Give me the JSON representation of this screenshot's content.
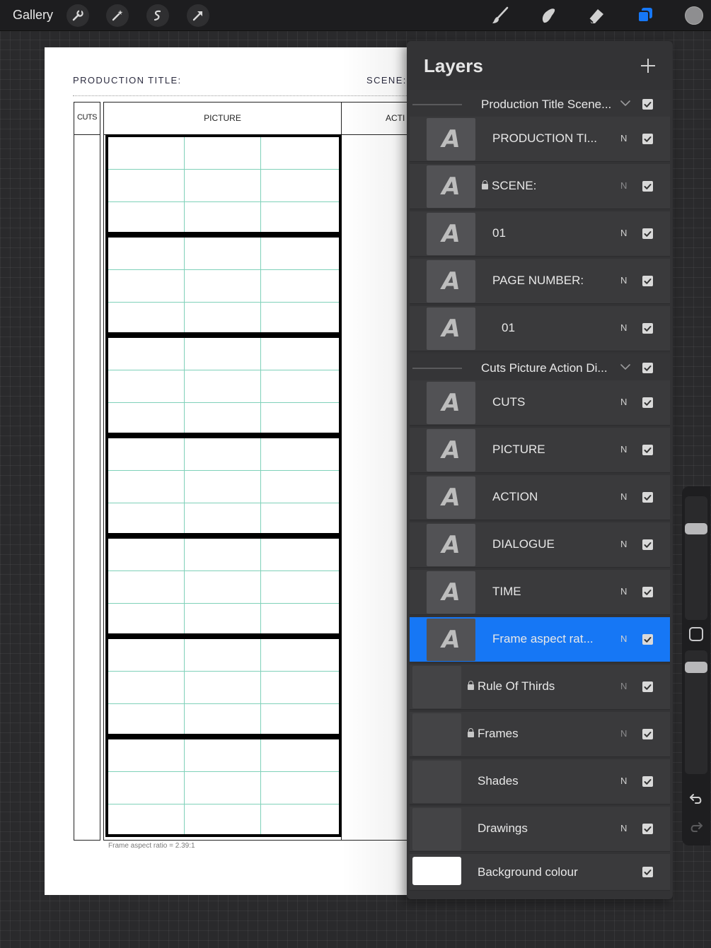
{
  "toolbar": {
    "gallery_label": "Gallery",
    "left_tools": [
      {
        "icon": "wrench-icon"
      },
      {
        "icon": "magic-wand-icon"
      },
      {
        "icon": "selection-icon"
      },
      {
        "icon": "transform-arrow-icon"
      }
    ],
    "right_tools": [
      {
        "icon": "brush-icon"
      },
      {
        "icon": "smudge-icon"
      },
      {
        "icon": "eraser-icon"
      },
      {
        "icon": "layers-icon",
        "active": true
      }
    ],
    "color_swatch": "#8e8e90",
    "accent": "#1677f5"
  },
  "canvas": {
    "production_title": "PRODUCTION TITLE:",
    "scene_label": "SCENE:",
    "columns": {
      "cuts": "CUTS",
      "picture": "PICTURE",
      "action": "ACTI"
    },
    "frame_count": 7,
    "frame_caption": "Frame aspect ratio = 2.39:1",
    "grid_color": "#7fd1b9"
  },
  "layers": {
    "title": "Layers",
    "rows": [
      {
        "type": "group",
        "name": "Production Title Scene...",
        "visible": true
      },
      {
        "type": "text",
        "name": "PRODUCTION TI...",
        "blend": "N",
        "locked": false,
        "visible": true
      },
      {
        "type": "text",
        "name": "SCENE:",
        "blend": "N",
        "locked": true,
        "visible": true
      },
      {
        "type": "text",
        "name": "01",
        "blend": "N",
        "locked": false,
        "visible": true
      },
      {
        "type": "text",
        "name": "PAGE NUMBER:",
        "blend": "N",
        "locked": false,
        "visible": true
      },
      {
        "type": "text",
        "name": "01",
        "blend": "N",
        "locked": false,
        "visible": true
      },
      {
        "type": "group",
        "name": "Cuts Picture Action Di...",
        "visible": true
      },
      {
        "type": "text",
        "name": "CUTS",
        "blend": "N",
        "locked": false,
        "visible": true
      },
      {
        "type": "text",
        "name": "PICTURE",
        "blend": "N",
        "locked": false,
        "visible": true
      },
      {
        "type": "text",
        "name": "ACTION",
        "blend": "N",
        "locked": false,
        "visible": true
      },
      {
        "type": "text",
        "name": "DIALOGUE",
        "blend": "N",
        "locked": false,
        "visible": true
      },
      {
        "type": "text",
        "name": "TIME",
        "blend": "N",
        "locked": false,
        "visible": true
      },
      {
        "type": "text",
        "name": "Frame aspect rat...",
        "blend": "N",
        "locked": false,
        "visible": true,
        "selected": true
      },
      {
        "type": "image",
        "name": "Rule Of Thirds",
        "blend": "N",
        "locked": true,
        "visible": true
      },
      {
        "type": "image",
        "name": "Frames",
        "blend": "N",
        "locked": true,
        "visible": true
      },
      {
        "type": "image",
        "name": "Shades",
        "blend": "N",
        "locked": false,
        "visible": true
      },
      {
        "type": "image",
        "name": "Drawings",
        "blend": "N",
        "locked": false,
        "visible": true
      },
      {
        "type": "background",
        "name": "Background colour",
        "visible": true
      }
    ]
  },
  "sidebar": {
    "brush_size": 0.76,
    "opacity": 0.9
  }
}
